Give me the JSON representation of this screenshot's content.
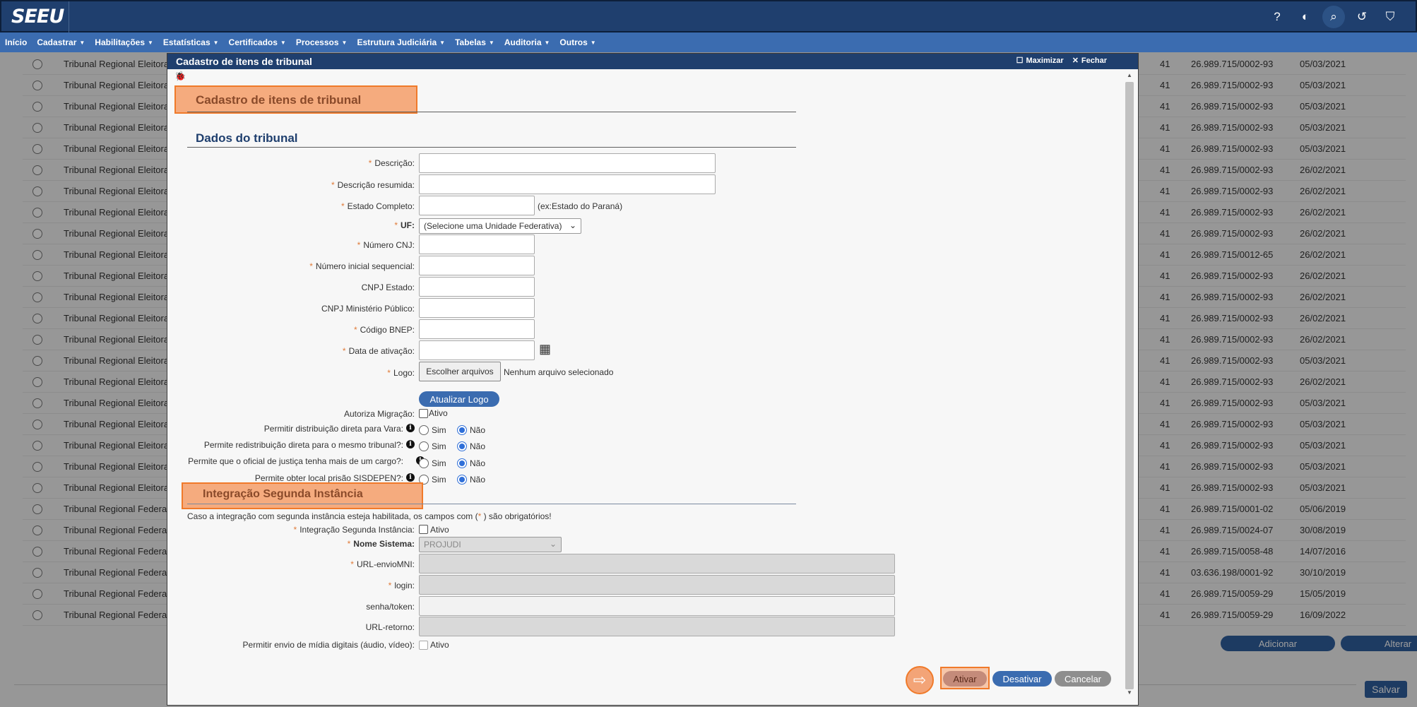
{
  "app": {
    "logo": "SEEU"
  },
  "top_icons": [
    {
      "name": "help-icon",
      "glyph": "?"
    },
    {
      "name": "theme-icon",
      "glyph": "◐"
    },
    {
      "name": "search-icon",
      "glyph": "⌕"
    },
    {
      "name": "history-icon",
      "glyph": "↺"
    },
    {
      "name": "bookmark-icon",
      "glyph": "⛉"
    }
  ],
  "menu": [
    {
      "label": "Início",
      "caret": false
    },
    {
      "label": "Cadastrar",
      "caret": true
    },
    {
      "label": "Habilitações",
      "caret": true
    },
    {
      "label": "Estatísticas",
      "caret": true
    },
    {
      "label": "Certificados",
      "caret": true
    },
    {
      "label": "Processos",
      "caret": true
    },
    {
      "label": "Estrutura Judiciária",
      "caret": true
    },
    {
      "label": "Tabelas",
      "caret": true
    },
    {
      "label": "Auditoria",
      "caret": true
    },
    {
      "label": "Outros",
      "caret": true
    }
  ],
  "background_table": {
    "rows": [
      {
        "name": "Tribunal Regional Eleitoral de",
        "id": "41",
        "cnpj": "26.989.715/0002-93",
        "date": "05/03/2021"
      },
      {
        "name": "Tribunal Regional Eleitoral de",
        "id": "41",
        "cnpj": "26.989.715/0002-93",
        "date": "05/03/2021"
      },
      {
        "name": "Tribunal Regional Eleitoral de",
        "id": "41",
        "cnpj": "26.989.715/0002-93",
        "date": "05/03/2021"
      },
      {
        "name": "Tribunal Regional Eleitoral de",
        "id": "41",
        "cnpj": "26.989.715/0002-93",
        "date": "05/03/2021"
      },
      {
        "name": "Tribunal Regional Eleitoral de",
        "id": "41",
        "cnpj": "26.989.715/0002-93",
        "date": "05/03/2021"
      },
      {
        "name": "Tribunal Regional Eleitoral do",
        "id": "41",
        "cnpj": "26.989.715/0002-93",
        "date": "26/02/2021"
      },
      {
        "name": "Tribunal Regional Eleitoral do",
        "id": "41",
        "cnpj": "26.989.715/0002-93",
        "date": "26/02/2021"
      },
      {
        "name": "Tribunal Regional Eleitoral do",
        "id": "41",
        "cnpj": "26.989.715/0002-93",
        "date": "26/02/2021"
      },
      {
        "name": "Tribunal Regional Eleitoral do",
        "id": "41",
        "cnpj": "26.989.715/0002-93",
        "date": "26/02/2021"
      },
      {
        "name": "Tribunal Regional Eleitoral do",
        "id": "41",
        "cnpj": "26.989.715/0012-65",
        "date": "26/02/2021"
      },
      {
        "name": "Tribunal Regional Eleitoral do",
        "id": "41",
        "cnpj": "26.989.715/0002-93",
        "date": "26/02/2021"
      },
      {
        "name": "Tribunal Regional Eleitoral do",
        "id": "41",
        "cnpj": "26.989.715/0002-93",
        "date": "26/02/2021"
      },
      {
        "name": "Tribunal Regional Eleitoral do",
        "id": "41",
        "cnpj": "26.989.715/0002-93",
        "date": "26/02/2021"
      },
      {
        "name": "Tribunal Regional Eleitoral do",
        "id": "41",
        "cnpj": "26.989.715/0002-93",
        "date": "26/02/2021"
      },
      {
        "name": "Tribunal Regional Eleitoral do",
        "id": "41",
        "cnpj": "26.989.715/0002-93",
        "date": "05/03/2021"
      },
      {
        "name": "Tribunal Regional Eleitoral do",
        "id": "41",
        "cnpj": "26.989.715/0002-93",
        "date": "26/02/2021"
      },
      {
        "name": "Tribunal Regional Eleitoral do",
        "id": "41",
        "cnpj": "26.989.715/0002-93",
        "date": "05/03/2021"
      },
      {
        "name": "Tribunal Regional Eleitoral do",
        "id": "41",
        "cnpj": "26.989.715/0002-93",
        "date": "05/03/2021"
      },
      {
        "name": "Tribunal Regional Eleitoral do",
        "id": "41",
        "cnpj": "26.989.715/0002-93",
        "date": "05/03/2021"
      },
      {
        "name": "Tribunal Regional Eleitoral do",
        "id": "41",
        "cnpj": "26.989.715/0002-93",
        "date": "05/03/2021"
      },
      {
        "name": "Tribunal Regional Eleitoral do",
        "id": "41",
        "cnpj": "26.989.715/0002-93",
        "date": "05/03/2021"
      },
      {
        "name": "Tribunal Regional Federal da",
        "id": "41",
        "cnpj": "26.989.715/0001-02",
        "date": "05/06/2019"
      },
      {
        "name": "Tribunal Regional Federal da",
        "id": "41",
        "cnpj": "26.989.715/0024-07",
        "date": "30/08/2019"
      },
      {
        "name": "Tribunal Regional Federal da",
        "id": "41",
        "cnpj": "26.989.715/0058-48",
        "date": "14/07/2016"
      },
      {
        "name": "Tribunal Regional Federal da",
        "id": "41",
        "cnpj": "03.636.198/0001-92",
        "date": "30/10/2019"
      },
      {
        "name": "Tribunal Regional Federal da",
        "id": "41",
        "cnpj": "26.989.715/0059-29",
        "date": "15/05/2019"
      },
      {
        "name": "Tribunal Regional Federal da",
        "id": "41",
        "cnpj": "26.989.715/0059-29",
        "date": "16/09/2022"
      }
    ],
    "adicionar_label": "Adicionar",
    "alterar_label": "Alterar",
    "salvar_label": "Salvar"
  },
  "modal": {
    "title": "Cadastro de itens de tribunal",
    "maximizar_label": "Maximizar",
    "fechar_label": "Fechar",
    "page_heading": "Cadastro de itens de tribunal",
    "section_dados": "Dados do tribunal",
    "fields": {
      "descricao": "Descrição:",
      "descricao_resumida": "Descrição resumida:",
      "estado_completo": "Estado Completo:",
      "estado_hint": "(ex:Estado do Paraná)",
      "uf": "UF:",
      "uf_value": "(Selecione uma Unidade Federativa)",
      "numero_cnj": "Número CNJ:",
      "numero_inicial": "Número inicial sequencial:",
      "cnpj_estado": "CNPJ Estado:",
      "cnpj_mp": "CNPJ Ministério Público:",
      "codigo_bnep": "Código BNEP:",
      "data_ativacao": "Data de ativação:",
      "logo": "Logo:",
      "file_button": "Escolher arquivos",
      "file_status": "Nenhum arquivo selecionado",
      "atualizar_logo": "Atualizar Logo",
      "autoriza_migracao": "Autoriza Migração:",
      "ativo": "Ativo"
    },
    "radio_questions": [
      {
        "label": "Permitir distribuição direta para Vara:",
        "sim": "Sim",
        "nao": "Não",
        "selected": "nao"
      },
      {
        "label": "Permite redistribuição direta para o mesmo tribunal?:",
        "sim": "Sim",
        "nao": "Não",
        "selected": "nao"
      },
      {
        "label": "Permite que o oficial de justiça tenha mais de um cargo?:",
        "sim": "Sim",
        "nao": "Não",
        "selected": "nao"
      },
      {
        "label": "Permite obter local prisão SISDEPEN?:",
        "sim": "Sim",
        "nao": "Não",
        "selected": "nao"
      }
    ],
    "section_integracao": "Integração Segunda Instância",
    "integracao_note_pre": "Caso a integração com segunda instância esteja habilitada, os campos com (",
    "integracao_note_star": "*",
    "integracao_note_post": " ) são obrigatórios!",
    "integracao": {
      "integracao_label": "Integração Segunda Instância:",
      "ativo": "Ativo",
      "nome_sistema": "Nome Sistema:",
      "nome_sistema_value": "PROJUDI",
      "url_envio": "URL-envioMNI:",
      "login": "login:",
      "senha": "senha/token:",
      "url_retorno": "URL-retorno:",
      "midia": "Permitir envio de mídia digitais (áudio, vídeo):",
      "midia_ativo": "Ativo"
    },
    "buttons": {
      "ativar": "Ativar",
      "desativar": "Desativar",
      "cancelar": "Cancelar"
    }
  }
}
